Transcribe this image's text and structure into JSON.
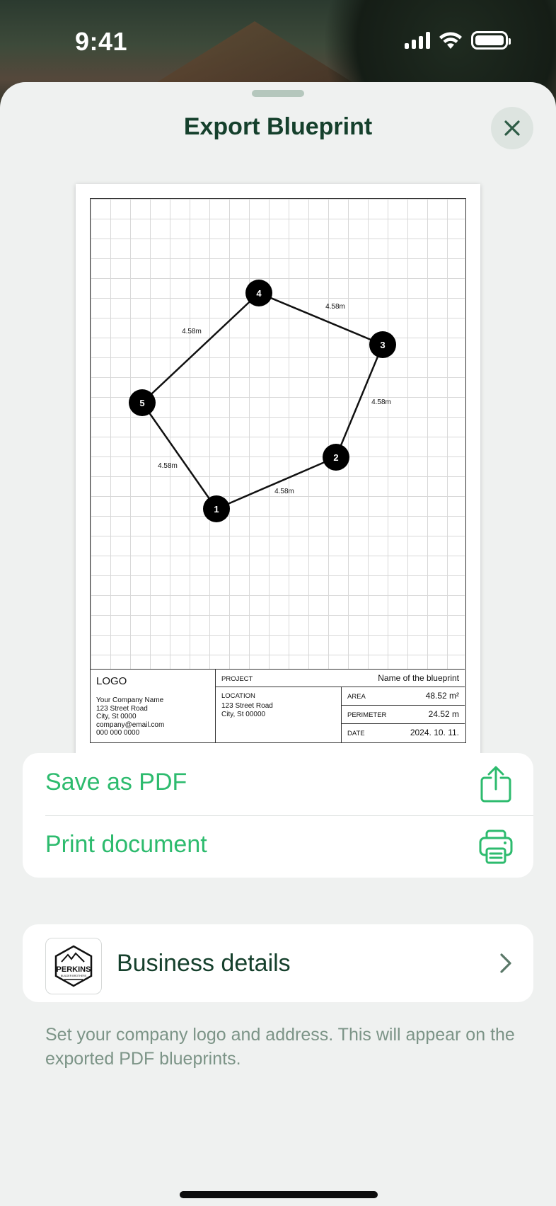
{
  "status_bar": {
    "time": "9:41"
  },
  "sheet": {
    "title": "Export Blueprint",
    "close_icon": "close-icon"
  },
  "blueprint": {
    "nodes": [
      {
        "label": "1"
      },
      {
        "label": "2"
      },
      {
        "label": "3"
      },
      {
        "label": "4"
      },
      {
        "label": "5"
      }
    ],
    "edges": [
      {
        "label": "4.58m"
      },
      {
        "label": "4.58m"
      },
      {
        "label": "4.58m"
      },
      {
        "label": "4.58m"
      },
      {
        "label": "4.58m"
      }
    ],
    "title_block": {
      "logo": "LOGO",
      "company_lines": [
        "Your Company Name",
        "123 Street Road",
        "City, St 0000",
        "company@email.com",
        "000 000 0000"
      ],
      "project_label": "PROJECT",
      "project_name": "Name of the blueprint",
      "location_label": "LOCATION",
      "location_lines": [
        "123 Street Road",
        "City, St 00000"
      ],
      "area_label": "AREA",
      "area_value": "48.52 m²",
      "perimeter_label": "PERIMETER",
      "perimeter_value": "24.52 m",
      "date_label": "DATE",
      "date_value": "2024. 10. 11."
    }
  },
  "actions": {
    "save_pdf": {
      "label": "Save as PDF",
      "icon": "share-icon"
    },
    "print": {
      "label": "Print document",
      "icon": "printer-icon"
    }
  },
  "business": {
    "label": "Business details",
    "logo_text": "PERKINS",
    "logo_subtext": "BUILDER BROTHERS",
    "hint": "Set your company logo and address. This will appear on the exported PDF blueprints."
  },
  "colors": {
    "accent": "#2dbb6e",
    "title": "#15402c",
    "sheet_bg": "#eff1f0"
  }
}
